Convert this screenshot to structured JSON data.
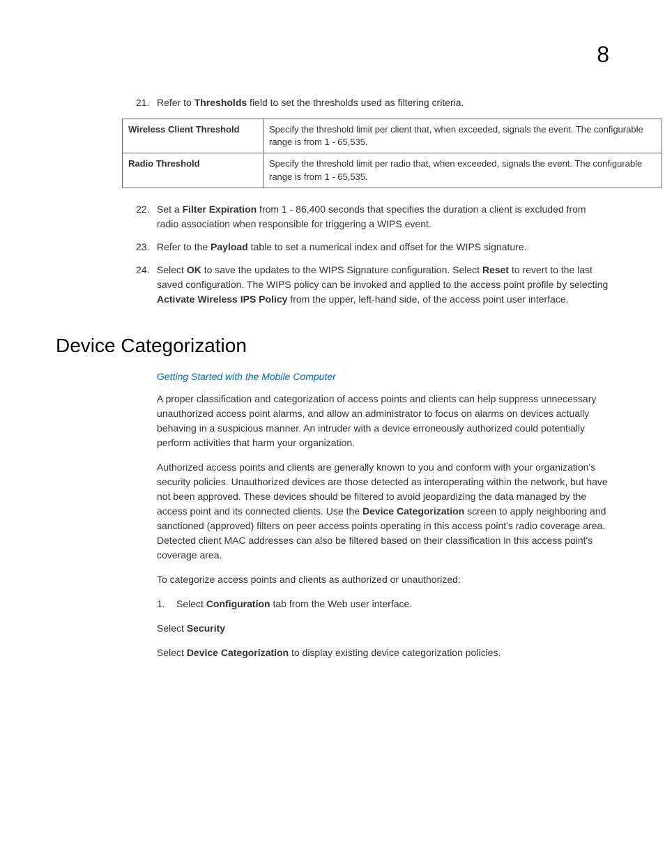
{
  "chapterNumber": "8",
  "item21": {
    "number": "21.",
    "pre": "Refer to ",
    "bold": "Thresholds",
    "post": " field to set the thresholds used as filtering criteria."
  },
  "table": {
    "row1": {
      "label": "Wireless Client Threshold",
      "desc": "Specify the threshold limit per client that, when exceeded, signals the event. The configurable range is from 1 - 65,535."
    },
    "row2": {
      "label": "Radio Threshold",
      "desc": "Specify the threshold limit per radio that, when exceeded, signals the event. The configurable range is from 1 - 65,535."
    }
  },
  "item22": {
    "number": "22.",
    "pre": "Set a ",
    "bold": "Filter Expiration",
    "post": " from 1 - 86,400 seconds that specifies the duration a client is excluded from radio association when responsible for triggering a WIPS event."
  },
  "item23": {
    "number": "23.",
    "pre": "Refer to the ",
    "bold": "Payload",
    "post": " table to set a numerical index and offset for the WIPS signature."
  },
  "item24": {
    "number": "24.",
    "pre": "Select ",
    "bold1": "OK",
    "mid1": " to save the updates to the WIPS Signature configuration. Select ",
    "bold2": "Reset",
    "mid2": " to revert to the last saved configuration. The WIPS policy can be invoked and applied to the access point profile by selecting ",
    "bold3": "Activate Wireless IPS Policy",
    "post": " from the upper, left-hand side, of the access point user interface."
  },
  "sectionHeading": "Device Categorization",
  "subtitleLink": "Getting Started with the Mobile Computer",
  "para1": "A proper classification and categorization of access points and clients can help suppress unnecessary unauthorized access point alarms, and allow an administrator to focus on alarms on devices actually behaving in a suspicious manner. An intruder with a device erroneously authorized could potentially perform activities that harm your organization.",
  "para2": {
    "pre": "Authorized access points and clients are generally known to you and conform with your organization's security policies. Unauthorized devices are those detected as interoperating within the network, but have not been approved. These devices should be filtered to avoid jeopardizing the data managed by the access point and its connected clients. Use the ",
    "bold": "Device Categorization",
    "post": " screen to apply neighboring and sanctioned (approved) filters on peer access points operating in this access point's radio coverage area. Detected client MAC addresses can also be filtered based on their classification in this access point's coverage area."
  },
  "para3": "To categorize access points and clients as authorized or unauthorized:",
  "step1": {
    "number": "1.",
    "pre": "Select ",
    "bold": "Configuration",
    "post": " tab from the Web user interface."
  },
  "step2": {
    "pre": "Select ",
    "bold": "Security"
  },
  "step3": {
    "pre": "Select ",
    "bold": "Device Categorization",
    "post": " to display existing device categorization policies."
  }
}
